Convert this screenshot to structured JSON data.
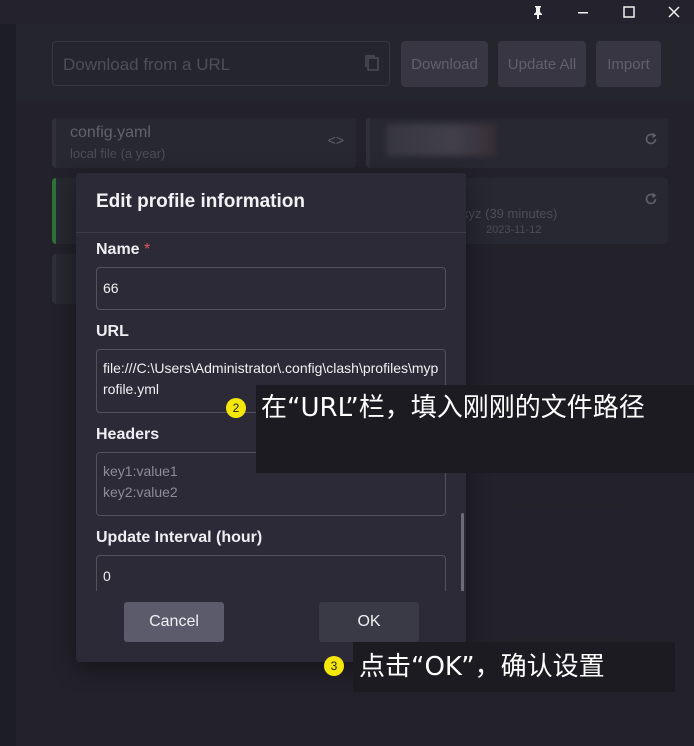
{
  "titlebar": {
    "pin_icon": "pin-icon",
    "minimize_icon": "minimize-icon",
    "maximize_icon": "maximize-icon",
    "close_icon": "close-icon"
  },
  "toolbar": {
    "url_placeholder": "Download from a URL",
    "download_label": "Download",
    "update_all_label": "Update All",
    "import_label": "Import"
  },
  "profiles": {
    "card1_title": "config.yaml",
    "card1_sub": "local file (a year)",
    "card2_sub": "xyz (39 minutes)",
    "card2_date": "2023-11-12"
  },
  "dialog": {
    "title": "Edit profile information",
    "name_label": "Name",
    "required_mark": "*",
    "name_value": "66",
    "url_label": "URL",
    "url_value": "file:///C:\\Users\\Administrator\\.config\\clash\\profiles\\myprofile.yml",
    "headers_label": "Headers",
    "headers_placeholder_1": "key1:value1",
    "headers_placeholder_2": "key2:value2",
    "interval_label": "Update Interval (hour)",
    "interval_value": "0",
    "cancel_label": "Cancel",
    "ok_label": "OK"
  },
  "annotations": {
    "step2_num": "2",
    "step2_text": "在“URL”栏，填入刚刚的文件路径",
    "step3_num": "3",
    "step3_text": "点击“OK”，确认设置"
  },
  "colors": {
    "accent_green": "#3fa54a",
    "step_badge": "#f5e70c",
    "required": "#e05656"
  }
}
